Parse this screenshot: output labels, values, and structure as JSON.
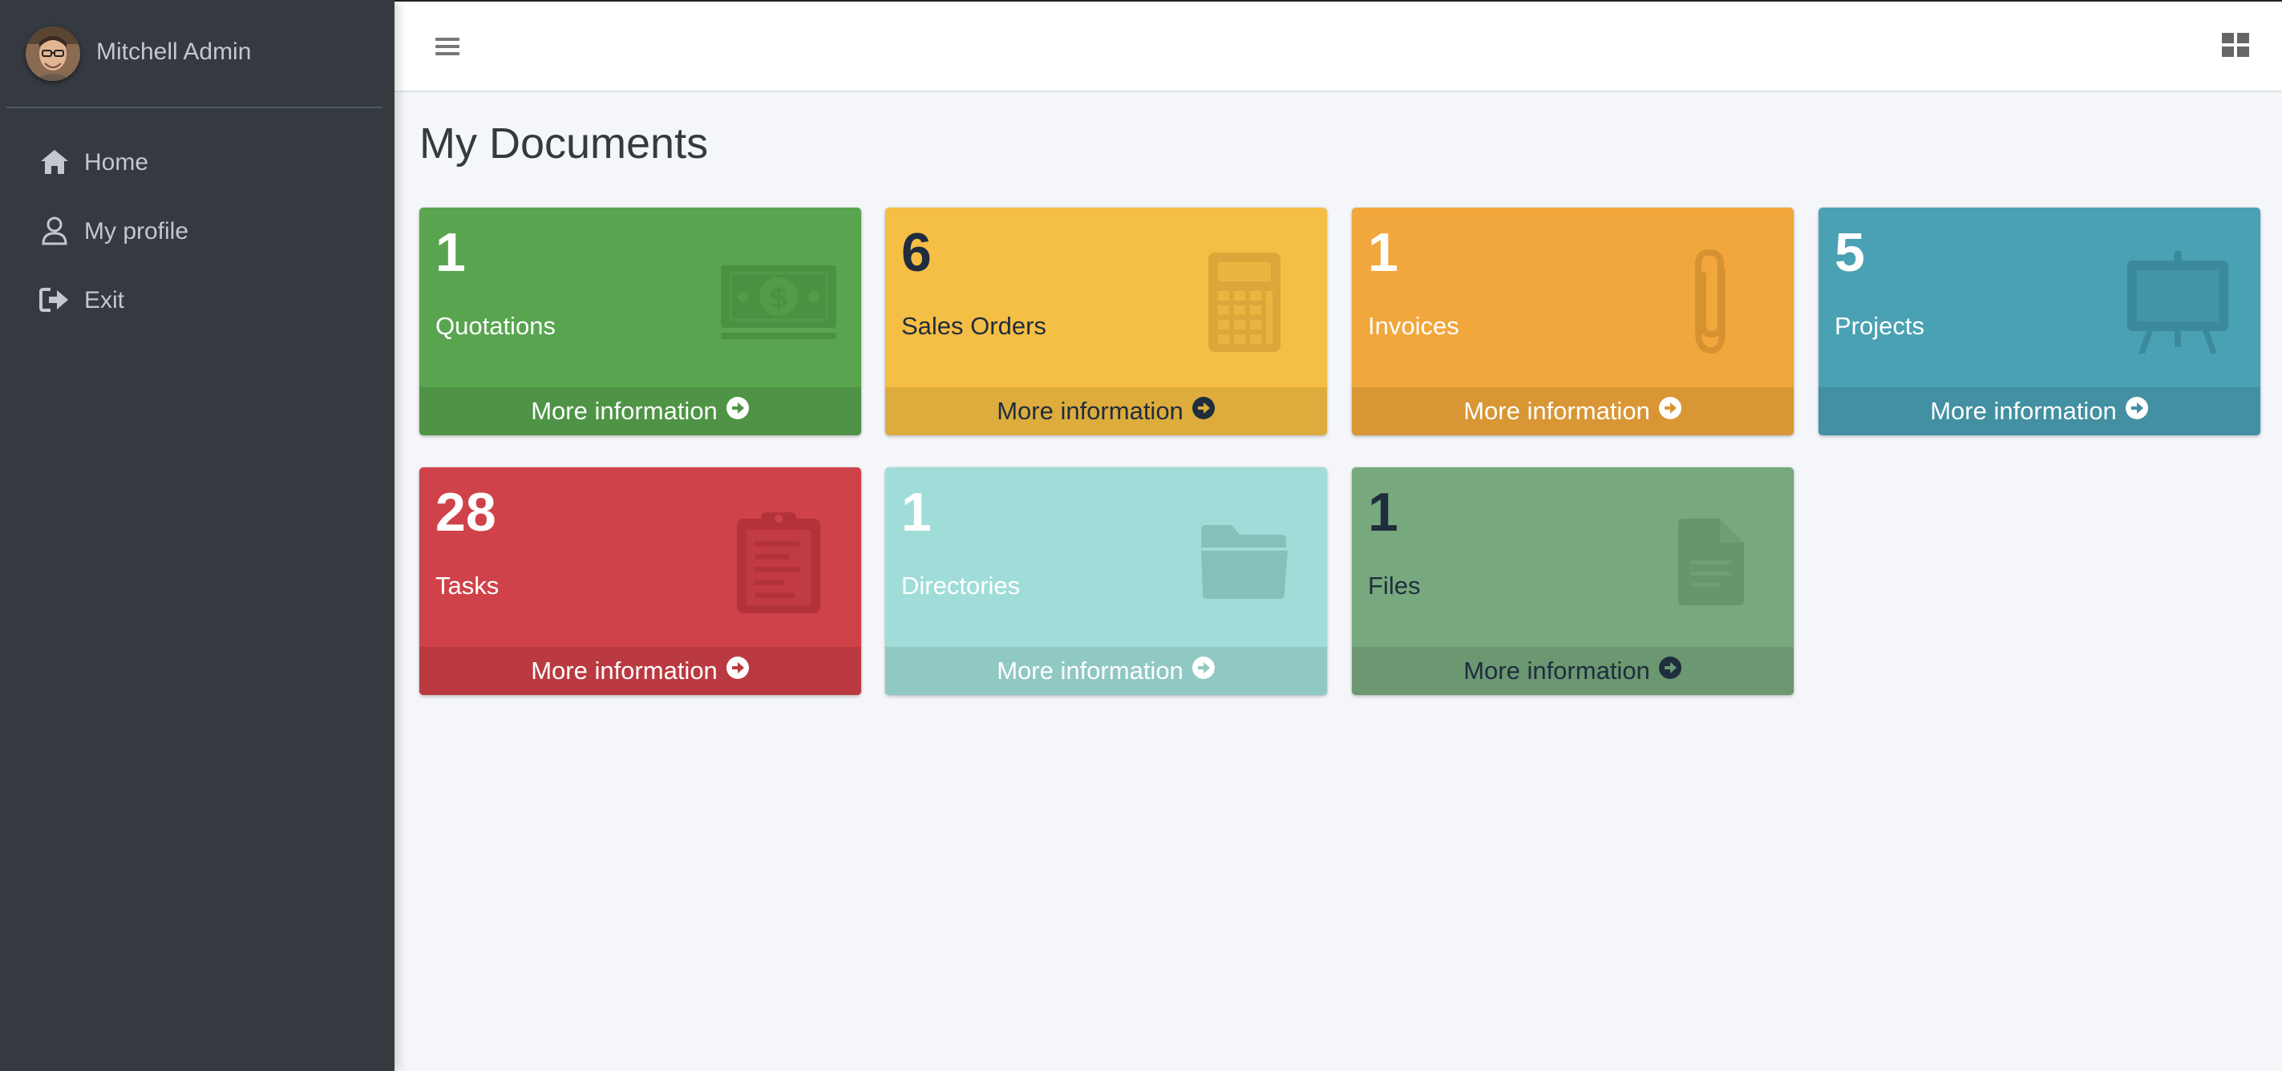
{
  "user": {
    "name": "Mitchell Admin"
  },
  "nav": {
    "items": [
      {
        "label": "Home",
        "icon": "home-icon"
      },
      {
        "label": "My profile",
        "icon": "user-icon"
      },
      {
        "label": "Exit",
        "icon": "sign-out-icon"
      }
    ]
  },
  "page": {
    "title": "My Documents"
  },
  "boxes": [
    {
      "count": "1",
      "label": "Quotations",
      "footer": "More information",
      "icon": "money-bill-icon",
      "bg": "#59a44f",
      "footer_bg": "#4f9446",
      "text": "light",
      "icon_color": "#4a9142"
    },
    {
      "count": "6",
      "label": "Sales Orders",
      "footer": "More information",
      "icon": "calculator-icon",
      "bg": "#f5be45",
      "footer_bg": "#ddac3d",
      "text": "dark",
      "icon_color": "#dba73a"
    },
    {
      "count": "1",
      "label": "Invoices",
      "footer": "More information",
      "icon": "paperclip-icon",
      "bg": "#f1a73c",
      "footer_bg": "#d99634",
      "text": "light",
      "icon_color": "#d69230"
    },
    {
      "count": "5",
      "label": "Projects",
      "footer": "More information",
      "icon": "easel-icon",
      "bg": "#4aa1b4",
      "footer_bg": "#4290a2",
      "text": "light",
      "icon_color": "#3b8a9c"
    },
    {
      "count": "28",
      "label": "Tasks",
      "footer": "More information",
      "icon": "clipboard-icon",
      "bg": "#cf4249",
      "footer_bg": "#bb3a41",
      "text": "light",
      "icon_color": "#b4333a"
    },
    {
      "count": "1",
      "label": "Directories",
      "footer": "More information",
      "icon": "folder-icon",
      "bg": "#a0ddd8",
      "footer_bg": "#90c8c3",
      "text": "light",
      "icon_color": "#84c1bb"
    },
    {
      "count": "1",
      "label": "Files",
      "footer": "More information",
      "icon": "file-icon",
      "bg": "#78a87d",
      "footer_bg": "#6b9771",
      "text": "dark",
      "icon_color": "#67956c"
    }
  ]
}
